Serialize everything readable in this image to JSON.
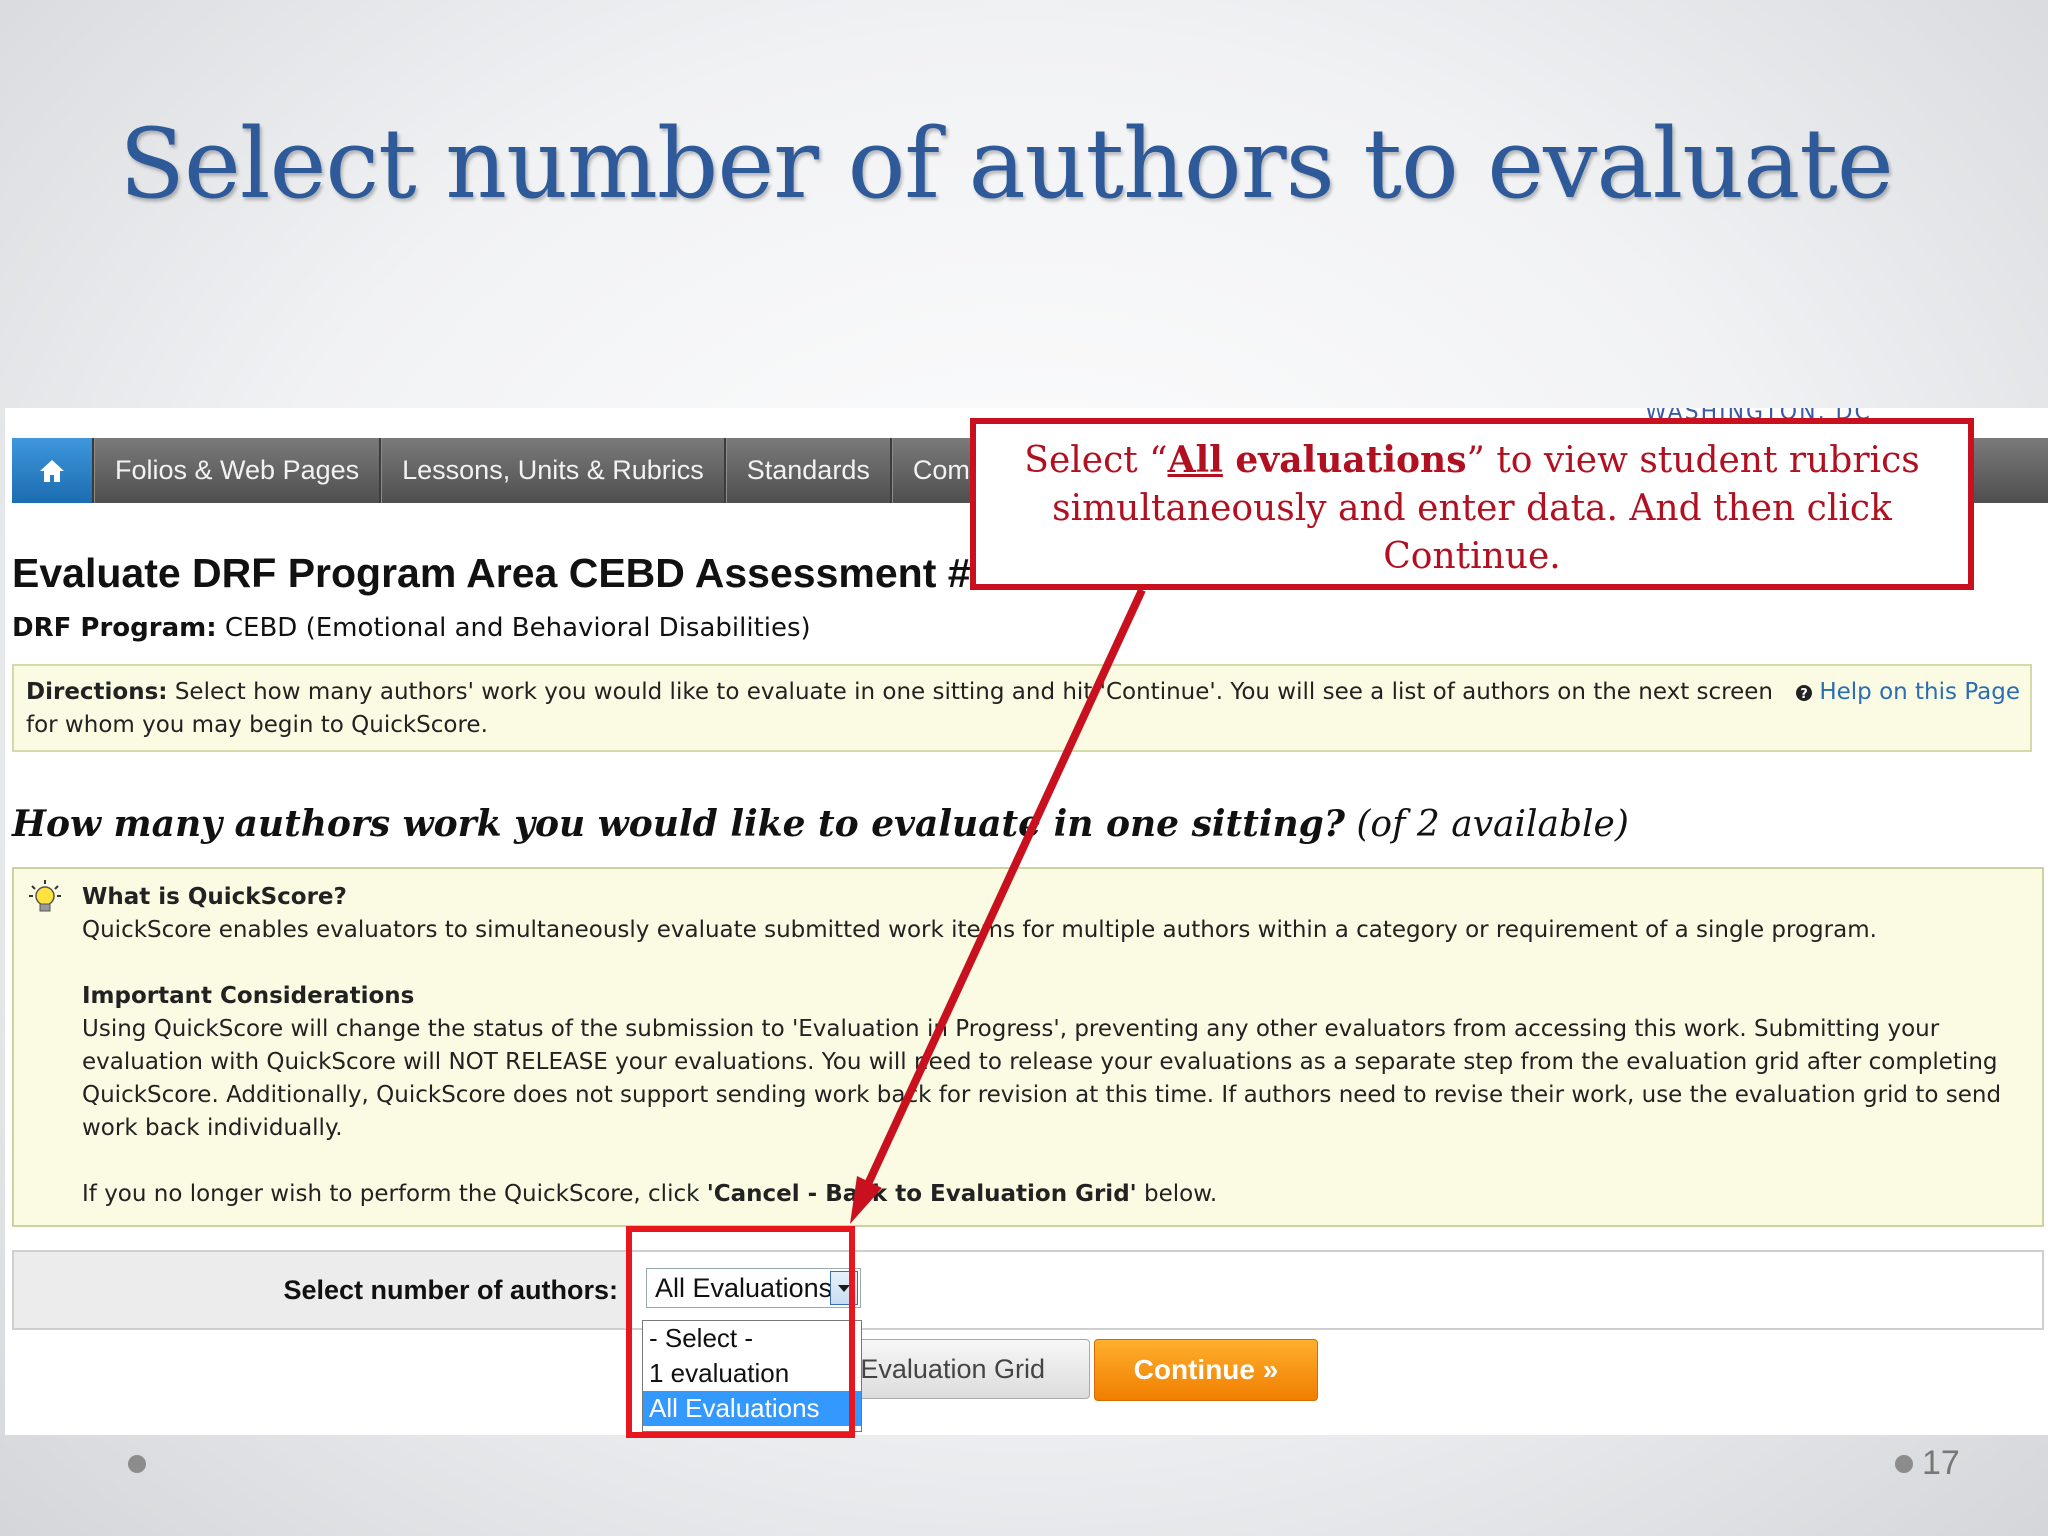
{
  "slide": {
    "title": "Select number of authors to evaluate",
    "page_number": "17"
  },
  "app": {
    "top_partial_text": "WASHINGTON, DC",
    "nav": {
      "home_icon": "home-icon",
      "items": [
        "Folios & Web Pages",
        "Lessons, Units & Rubrics",
        "Standards",
        "Commu"
      ]
    },
    "page_title": "Evaluate DRF Program Area CEBD Assessment #",
    "program": {
      "label": "DRF Program:",
      "value": "CEBD (Emotional and Behavioral Disabilities)"
    },
    "directions": {
      "label": "Directions:",
      "text": "Select how many authors' work you would like to evaluate in one sitting and hit 'Continue'. You will see a list of authors on the next screen for whom you may begin to QuickScore.",
      "help_link": "Help on this Page"
    },
    "question": {
      "main": "How many authors work you would like to evaluate in one sitting?",
      "sub": "(of 2 available)"
    },
    "info": {
      "what_heading": "What is QuickScore?",
      "what_text": "QuickScore enables evaluators to simultaneously evaluate submitted work items for multiple authors within a category or requirement of a single program.",
      "considerations_heading": "Important Considerations",
      "considerations_text": "Using QuickScore will change the status of the submission to 'Evaluation in Progress', preventing any other evaluators from accessing this work. Submitting your evaluation with QuickScore will NOT RELEASE your evaluations. You will need to release your evaluations as a separate step from the evaluation grid after completing QuickScore. Additionally, QuickScore does not support sending work back for revision at this time. If authors need to revise their work, use the evaluation grid to send work back individually.",
      "cancel_prefix": "If you no longer wish to perform the QuickScore, click ",
      "cancel_bold": "'Cancel - Back to Evaluation Grid'",
      "cancel_suffix": " below."
    },
    "select": {
      "label": "Select number of authors:",
      "value": "All Evaluations",
      "options": [
        "- Select -",
        "1 evaluation",
        "All Evaluations"
      ],
      "selected_index": 2
    },
    "buttons": {
      "back": "Evaluation Grid",
      "continue": "Continue »"
    }
  },
  "callout": {
    "open": "Select “",
    "emph_underlined": "All",
    "emph_rest": " evaluations",
    "close": "” to view student rubrics simultaneously and enter data. And then click Continue.",
    "color": "#c8101e"
  }
}
